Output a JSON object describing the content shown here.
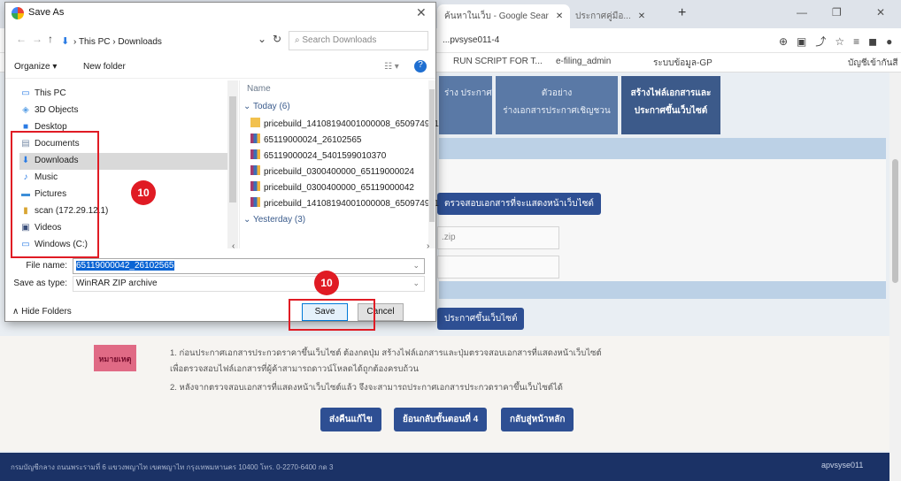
{
  "browser": {
    "tabs": [
      {
        "label": "ค้นหาในเว็บ - Google Sear",
        "active": true
      },
      {
        "label": "ประกาศคู่มือ...",
        "active": false
      }
    ],
    "address": "...pvsyse011-4",
    "bookmarks": [
      "RUN SCRIPT FOR T...",
      "e-filing_admin",
      "ระบบข้อมูล-GP",
      "บัญชีเข้ากันสี"
    ]
  },
  "page": {
    "step_tabs": [
      {
        "label": "ร่าง\nประกาศราคา",
        "active": false
      },
      {
        "label": "ตัวอย่าง\nร่างเอกสารประกาศเชิญชวน",
        "active": false
      },
      {
        "label": "สร้างไฟล์เอกสารและ\nประกาศขึ้นเว็บไซต์",
        "active": true
      }
    ],
    "create_docs_button": "ตรวจสอบเอกสารที่จะแสดงหน้าเว็บไซต์",
    "zip_field": ".zip",
    "publish_button": "ประกาศขึ้นเว็บไซต์",
    "note_badge": "หมายเหตุ",
    "notes": [
      "1. ก่อนประกาศเอกสารประกวดราคาขึ้นเว็บไซต์ ต้องกดปุ่ม สร้างไฟล์เอกสารและปุ่มตรวจสอบเอกสารที่แสดงหน้าเว็บไซต์",
      "เพื่อตรวจสอบไฟล์เอกสารที่ผู้ค้าสามารถดาวน์โหลดได้ถูกต้องครบถ้วน",
      "2. หลังจากตรวจสอบเอกสารที่แสดงหน้าเว็บไซต์แล้ว จึงจะสามารถประกาศเอกสารประกวดราคาขึ้นเว็บไซต์ได้"
    ],
    "action_buttons": [
      "ส่งคืนแก้ไข",
      "ย้อนกลับขั้นตอนที่ 4",
      "กลับสู่หน้าหลัก"
    ],
    "footer_text": "กรมบัญชีกลาง ถนนพระรามที่ 6 แขวงพญาไท เขตพญาไท กรุงเทพมหานคร 10400 โทร. 0-2270-6400 กด 3",
    "footer_right": "apvsyse011"
  },
  "dialog": {
    "title": "Save As",
    "path_segments": [
      "This PC",
      "Downloads"
    ],
    "search_placeholder": "Search Downloads",
    "toolbar": {
      "organize": "Organize ▾",
      "new_folder": "New folder"
    },
    "tree": [
      {
        "label": "This PC",
        "icon": "pc-icon",
        "selected": false
      },
      {
        "label": "3D Objects",
        "icon": "cube-icon",
        "selected": false
      },
      {
        "label": "Desktop",
        "icon": "desktop-icon",
        "selected": false
      },
      {
        "label": "Documents",
        "icon": "document-icon",
        "selected": false
      },
      {
        "label": "Downloads",
        "icon": "download-icon",
        "selected": true
      },
      {
        "label": "Music",
        "icon": "music-icon",
        "selected": false
      },
      {
        "label": "Pictures",
        "icon": "pictures-icon",
        "selected": false
      },
      {
        "label": "scan (172.29.12.1)",
        "icon": "network-drive-icon",
        "selected": false
      },
      {
        "label": "Videos",
        "icon": "video-icon",
        "selected": false
      },
      {
        "label": "Windows (C:)",
        "icon": "drive-icon",
        "selected": false
      }
    ],
    "column_name": "Name",
    "groups": [
      {
        "label": "Today (6)",
        "files": [
          {
            "name": "pricebuild_14108194001000008_650974911",
            "icon": "folder-icon"
          },
          {
            "name": "65119000024_26102565",
            "icon": "zip-icon"
          },
          {
            "name": "65119000024_5401599010370",
            "icon": "zip-icon"
          },
          {
            "name": "pricebuild_0300400000_65119000024",
            "icon": "zip-icon"
          },
          {
            "name": "pricebuild_0300400000_65119000042",
            "icon": "zip-icon"
          },
          {
            "name": "pricebuild_14108194001000008_650974911",
            "icon": "zip-icon"
          }
        ]
      },
      {
        "label": "Yesterday (3)",
        "files": []
      }
    ],
    "file_name_label": "File name:",
    "file_name_value": "65119000042_26102565",
    "save_type_label": "Save as type:",
    "save_type_value": "WinRAR ZIP archive",
    "hide_folders": "Hide Folders",
    "save_button": "Save",
    "cancel_button": "Cancel"
  },
  "annotations": {
    "left_number": "10",
    "bottom_number": "10",
    "color": "#e01b24"
  }
}
